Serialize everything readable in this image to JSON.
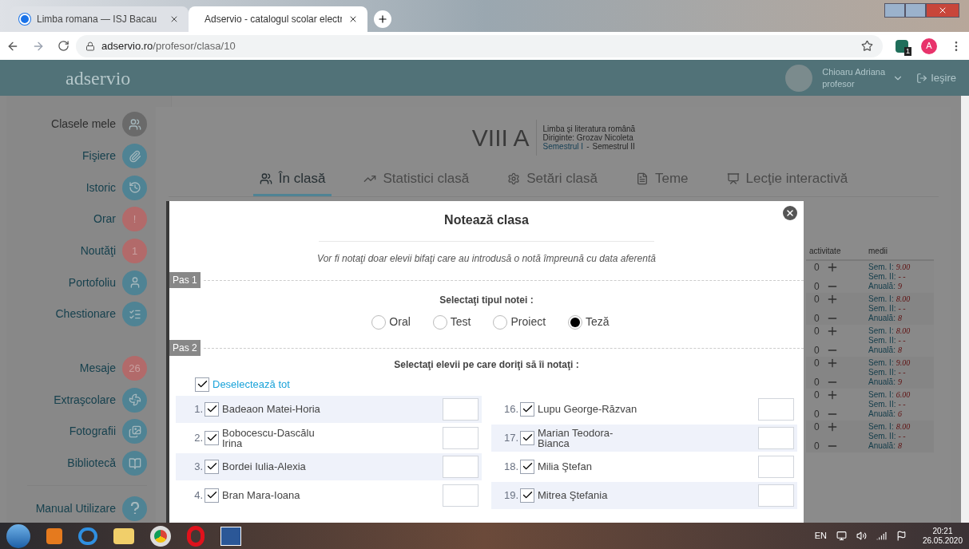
{
  "browser": {
    "tabs": [
      {
        "title": "Limba romana — ISJ Bacau",
        "selected": false
      },
      {
        "title": "Adservio - catalogul scolar electr",
        "selected": true
      }
    ],
    "url_host": "adservio.ro",
    "url_path": "/profesor/clasa/10",
    "profile_initial": "A",
    "extension_badge": "1"
  },
  "app_header": {
    "logo": "adservio",
    "user_name": "Chioaru Adriana",
    "user_role": "profesor",
    "logout": "Ieşire"
  },
  "sidebar": {
    "items": [
      {
        "label": "Clasele mele",
        "kind": "icon",
        "selected": true
      },
      {
        "label": "Fişiere",
        "kind": "icon",
        "selected": false
      },
      {
        "label": "Istoric",
        "kind": "icon",
        "selected": false
      },
      {
        "label": "Orar",
        "kind": "count",
        "badge": "!",
        "selected": false
      },
      {
        "label": "Noutăţi",
        "kind": "count",
        "badge": "1",
        "selected": false
      },
      {
        "label": "Portofoliu",
        "kind": "icon",
        "selected": false
      },
      {
        "label": "Chestionare",
        "kind": "icon",
        "selected": false
      },
      {
        "label": "Mesaje",
        "kind": "count",
        "badge": "26",
        "selected": false
      },
      {
        "label": "Extraşcolare",
        "kind": "icon",
        "selected": false
      },
      {
        "label": "Fotografii",
        "kind": "icon",
        "selected": false
      },
      {
        "label": "Bibliotecă",
        "kind": "icon",
        "selected": false
      }
    ],
    "footer_item": {
      "label": "Manual Utilizare"
    }
  },
  "class_header": {
    "title": "VIII A",
    "subject": "Limba şi literatura română",
    "teacher": "Diriginte: Grozav Nicoleta",
    "semesters": [
      {
        "label": "Semestrul I",
        "selected": true
      },
      {
        "label": "Semestrul II",
        "selected": false
      }
    ],
    "separator": "-"
  },
  "tabs": [
    {
      "label": "În clasă",
      "selected": true
    },
    {
      "label": "Statistici clasă",
      "selected": false
    },
    {
      "label": "Setări clasă",
      "selected": false
    },
    {
      "label": "Teme",
      "selected": false
    },
    {
      "label": "Lecţie interactivă",
      "selected": false
    }
  ],
  "grades_table": {
    "columns": [
      "activitate",
      "medii"
    ],
    "rows": [
      {
        "plus": "0",
        "minus": "0",
        "averages": [
          {
            "label": "Sem. I:",
            "value": "9.00"
          },
          {
            "label": "Sem. II:",
            "value": "- -"
          },
          {
            "label": "Anuală:",
            "value": "9"
          }
        ]
      },
      {
        "plus": "0",
        "minus": "0",
        "averages": [
          {
            "label": "Sem. I:",
            "value": "8.00"
          },
          {
            "label": "Sem. II:",
            "value": "- -"
          },
          {
            "label": "Anuală:",
            "value": "8"
          }
        ]
      },
      {
        "plus": "0",
        "minus": "0",
        "averages": [
          {
            "label": "Sem. I:",
            "value": "8.00"
          },
          {
            "label": "Sem. II:",
            "value": "- -"
          },
          {
            "label": "Anuală:",
            "value": "8"
          }
        ]
      },
      {
        "plus": "0",
        "minus": "0",
        "averages": [
          {
            "label": "Sem. I:",
            "value": "9.00"
          },
          {
            "label": "Sem. II:",
            "value": "- -"
          },
          {
            "label": "Anuală:",
            "value": "9"
          }
        ]
      },
      {
        "plus": "0",
        "minus": "0",
        "averages": [
          {
            "label": "Sem. I:",
            "value": "6.00"
          },
          {
            "label": "Sem. II:",
            "value": "- -"
          },
          {
            "label": "Anuală:",
            "value": "6"
          }
        ]
      },
      {
        "plus": "0",
        "minus": "0",
        "averages": [
          {
            "label": "Sem. I:",
            "value": "8.00"
          },
          {
            "label": "Sem. II:",
            "value": "- -"
          },
          {
            "label": "Anuală:",
            "value": "8"
          }
        ]
      }
    ]
  },
  "modal": {
    "title": "Notează clasa",
    "note": "Vor fi notaţi doar elevii bifaţi care au introdusă o notă împreună cu data aferentă",
    "step1": {
      "label": "Pas 1",
      "prompt": "Selectaţi tipul notei :"
    },
    "grade_types": [
      {
        "label": "Oral",
        "selected": false
      },
      {
        "label": "Test",
        "selected": false
      },
      {
        "label": "Proiect",
        "selected": false
      },
      {
        "label": "Teză",
        "selected": true
      }
    ],
    "step2": {
      "label": "Pas 2",
      "prompt": "Selectaţi elevii pe care doriţi să îi notaţi :"
    },
    "toggle_all": {
      "label": "Deselectează tot",
      "checked": true
    },
    "students_left": [
      {
        "number": "1.",
        "name": "Badeaon Matei-Horia",
        "checked": true
      },
      {
        "number": "2.",
        "name": "Bobocescu-Dascălu Irina",
        "checked": true
      },
      {
        "number": "3.",
        "name": "Bordei Iulia-Alexia",
        "checked": true
      },
      {
        "number": "4.",
        "name": "Bran Mara-Ioana",
        "checked": true
      }
    ],
    "students_right": [
      {
        "number": "16.",
        "name": "Lupu George-Răzvan",
        "checked": true
      },
      {
        "number": "17.",
        "name": "Marian Teodora-Bianca",
        "checked": true
      },
      {
        "number": "18.",
        "name": "Milia Ştefan",
        "checked": true
      },
      {
        "number": "19.",
        "name": "Mitrea Ştefania",
        "checked": true
      }
    ]
  },
  "taskbar": {
    "language": "EN",
    "time": "20:21",
    "date": "26.05.2020"
  }
}
